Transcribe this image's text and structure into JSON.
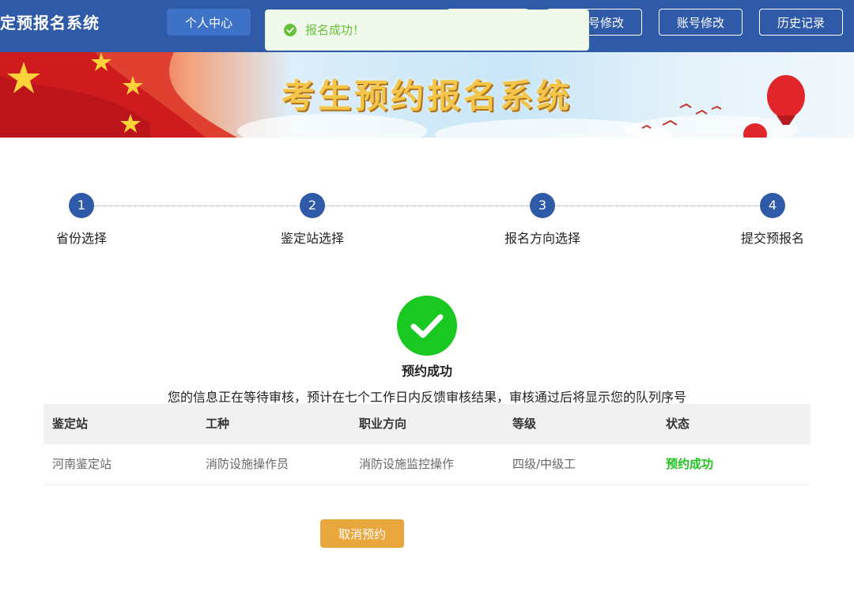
{
  "header": {
    "app_title": "定预报名系统",
    "nav": [
      {
        "label": "个人中心"
      },
      {
        "label": "号修改"
      },
      {
        "label": "账号修改"
      },
      {
        "label": "历史记录"
      }
    ]
  },
  "toast": {
    "message": "报名成功！",
    "icon": "check-circle-icon",
    "color": "#67c23a"
  },
  "banner": {
    "title": "考生预约报名系统"
  },
  "steps": [
    {
      "number": "1",
      "label": "省份选择"
    },
    {
      "number": "2",
      "label": "鉴定站选择"
    },
    {
      "number": "3",
      "label": "报名方向选择"
    },
    {
      "number": "4",
      "label": "提交预报名"
    }
  ],
  "result": {
    "icon": "checkmark-circle-icon",
    "title": "预约成功",
    "description": "您的信息正在等待审核，预计在七个工作日内反馈审核结果，审核通过后将显示您的队列序号"
  },
  "table": {
    "columns": [
      "鉴定站",
      "工种",
      "职业方向",
      "等级",
      "状态"
    ],
    "rows": [
      {
        "station": "河南鉴定站",
        "job": "消防设施操作员",
        "direction": "消防设施监控操作",
        "level": "四级/中级工",
        "status": "预约成功"
      }
    ]
  },
  "actions": {
    "cancel_label": "取消预约"
  },
  "colors": {
    "header": "#2f5aa8",
    "success": "#19c820",
    "status_text": "#1ec21e",
    "cancel_button": "#e8a63c"
  }
}
